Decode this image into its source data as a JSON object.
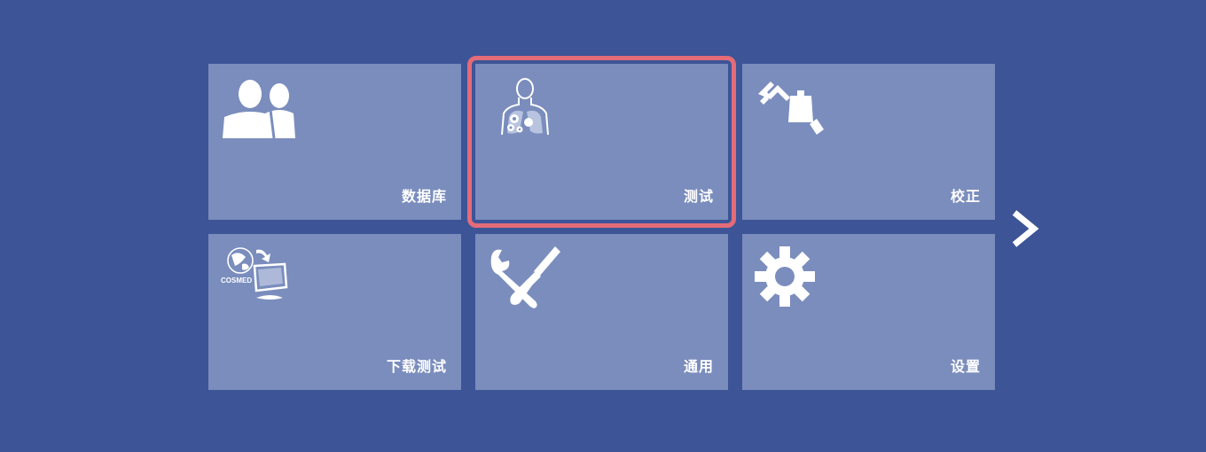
{
  "tiles": [
    {
      "label": "数据库",
      "icon": "users-icon"
    },
    {
      "label": "测试",
      "icon": "lungs-test-icon",
      "selected": true
    },
    {
      "label": "校正",
      "icon": "calibration-icon"
    },
    {
      "label": "下载测试",
      "icon": "download-test-icon",
      "brand": "COSMED"
    },
    {
      "label": "通用",
      "icon": "tools-icon"
    },
    {
      "label": "设置",
      "icon": "gear-icon"
    }
  ],
  "nav": {
    "next_icon": "chevron-right-icon"
  },
  "colors": {
    "background": "#3d5497",
    "tile": "#7a8dbd",
    "selection": "#e36c78",
    "text": "#ffffff"
  }
}
